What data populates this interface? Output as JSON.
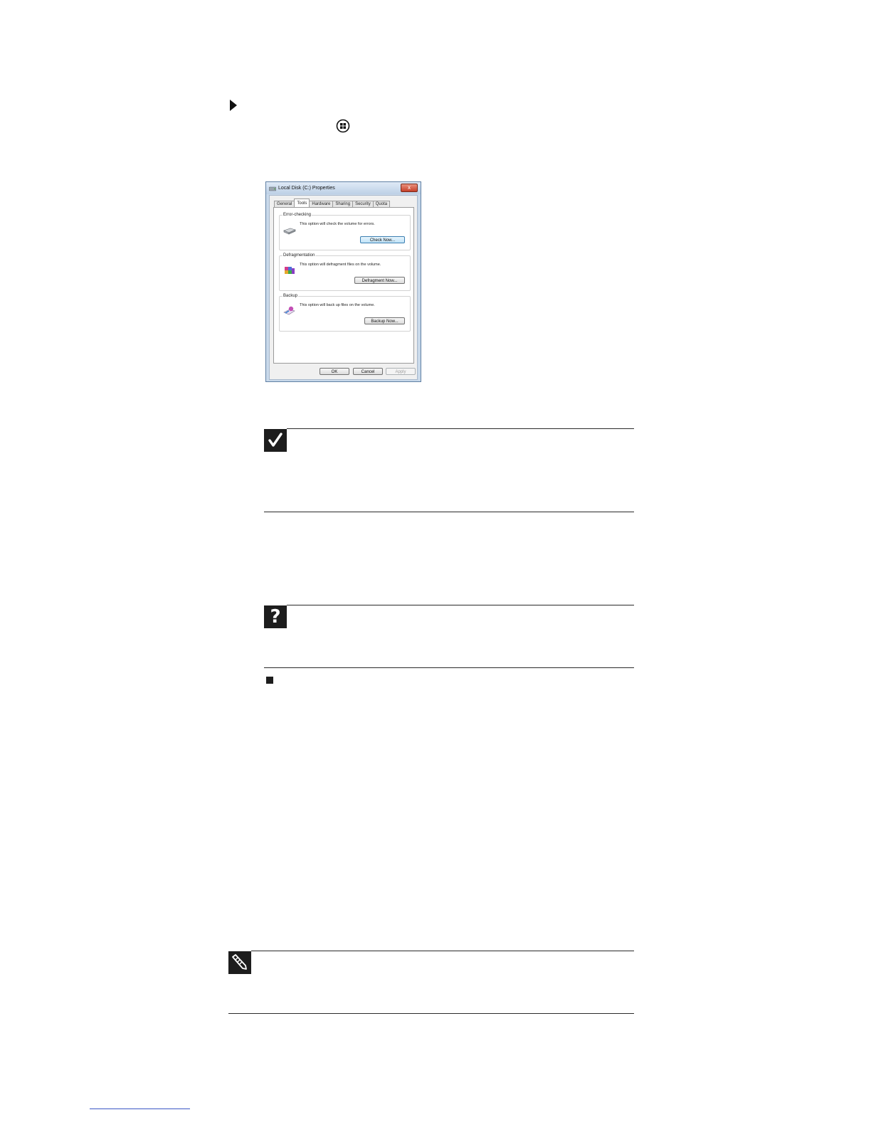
{
  "dialog": {
    "title": "Local Disk (C:) Properties",
    "close_label": "x",
    "tabs": [
      "General",
      "Tools",
      "Hardware",
      "Sharing",
      "Security",
      "Quota"
    ],
    "error_checking": {
      "title": "Error-checking",
      "text": "This option will check the volume for errors.",
      "button": "Check Now..."
    },
    "defragmentation": {
      "title": "Defragmentation",
      "text": "This option will defragment files on the volume.",
      "button": "Defragment Now..."
    },
    "backup": {
      "title": "Backup",
      "text": "This option will back up files on the volume.",
      "button": "Backup Now..."
    },
    "footer": {
      "ok": "OK",
      "cancel": "Cancel",
      "apply": "Apply"
    }
  }
}
